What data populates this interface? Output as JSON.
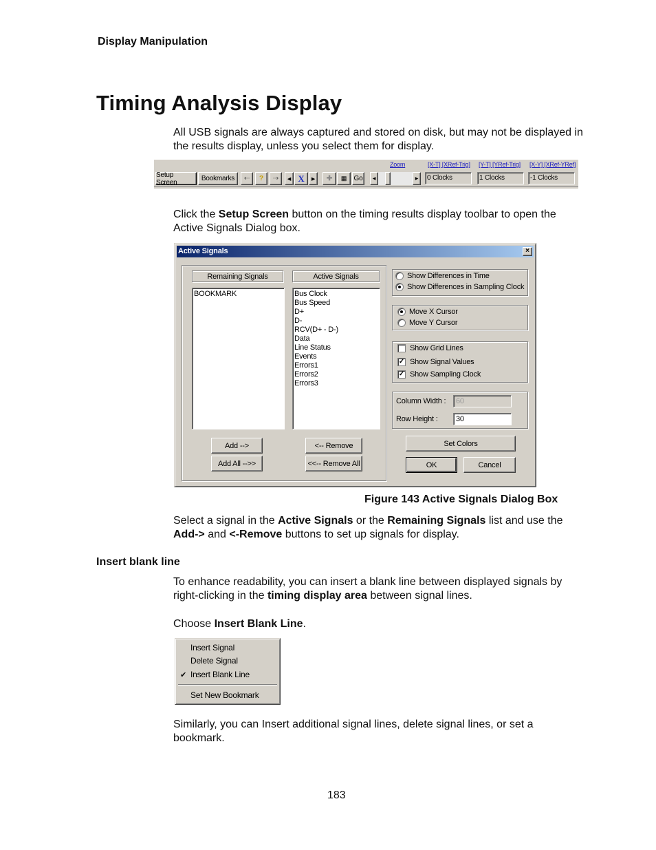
{
  "running_head": "Display Manipulation",
  "title": "Timing Analysis Display",
  "intro": "All USB signals are always captured and stored on disk, but may not be displayed in the results display, unless you select them for display.",
  "toolbar": {
    "setup_screen": "Setup Screen",
    "bookmarks": "Bookmarks",
    "icons": [
      "search-prev-icon",
      "search-binoculars-icon",
      "search-next-icon",
      "arrow-left-icon",
      "x-cursor-icon",
      "arrow-right-icon",
      "plus-icon",
      "grid-icon"
    ],
    "x_label": "X",
    "go": "Go",
    "zoom_link": "Zoom",
    "xt_link": "[X-T] [XRef-Trig]",
    "yt_link": "[Y-T] [YRef-Trig]",
    "xy_link": "[X-Y] [XRef-YRef]",
    "xt_value": "0 Clocks",
    "yt_value": "1 Clocks",
    "xy_value": "-1 Clocks"
  },
  "para_setup": {
    "pre": "Click the ",
    "bold": "Setup Screen",
    "post": " button on the timing results display toolbar to open the Active Signals Dialog box."
  },
  "dialog": {
    "title": "Active Signals",
    "close": "×",
    "remaining_header": "Remaining Signals",
    "active_header": "Active Signals",
    "remaining_list": [
      "BOOKMARK"
    ],
    "active_list": [
      "Bus Clock",
      "Bus Speed",
      "D+",
      "D-",
      "RCV(D+ - D-)",
      "Data",
      "Line Status",
      "Events",
      "Errors1",
      "Errors2",
      "Errors3"
    ],
    "add": "Add -->",
    "add_all": "Add All -->>",
    "remove": "<-- Remove",
    "remove_all": "<<-- Remove All",
    "diff_time": "Show Differences in Time",
    "diff_clock": "Show Differences in Sampling Clock",
    "diff_selected": "clock",
    "move_x": "Move X Cursor",
    "move_y": "Move Y Cursor",
    "move_selected": "x",
    "grid_lines": "Show Grid Lines",
    "grid_lines_checked": false,
    "signal_values": "Show Signal Values",
    "signal_values_checked": true,
    "sampling_clock": "Show Sampling Clock",
    "sampling_clock_checked": true,
    "column_width_label": "Column Width :",
    "column_width_value": "60",
    "row_height_label": "Row Height :",
    "row_height_value": "30",
    "set_colors": "Set Colors",
    "ok": "OK",
    "cancel": "Cancel"
  },
  "caption": "Figure  143  Active Signals Dialog Box",
  "para_select": {
    "t1": "Select a signal in the ",
    "b1": "Active Signals",
    "t2": " or the ",
    "b2": "Remaining Signals",
    "t3": " list and use the ",
    "b3": "Add->",
    "t4": " and ",
    "b4": "<-Remove",
    "t5": " buttons to set up signals for display."
  },
  "section2": "Insert blank line",
  "para_enhance": {
    "t1": "To enhance readability, you can insert a blank line between displayed signals by right-clicking in the ",
    "b1": "timing display area",
    "t2": " between signal lines."
  },
  "para_choose": {
    "t1": "Choose ",
    "b1": "Insert Blank Line",
    "t2": "."
  },
  "menu": {
    "items": [
      "Insert Signal",
      "Delete Signal",
      "Insert Blank Line",
      "Set New Bookmark"
    ],
    "checked": "✔"
  },
  "para_similar": "Similarly, you can Insert additional signal lines, delete signal lines, or set a bookmark.",
  "page_number": "183"
}
